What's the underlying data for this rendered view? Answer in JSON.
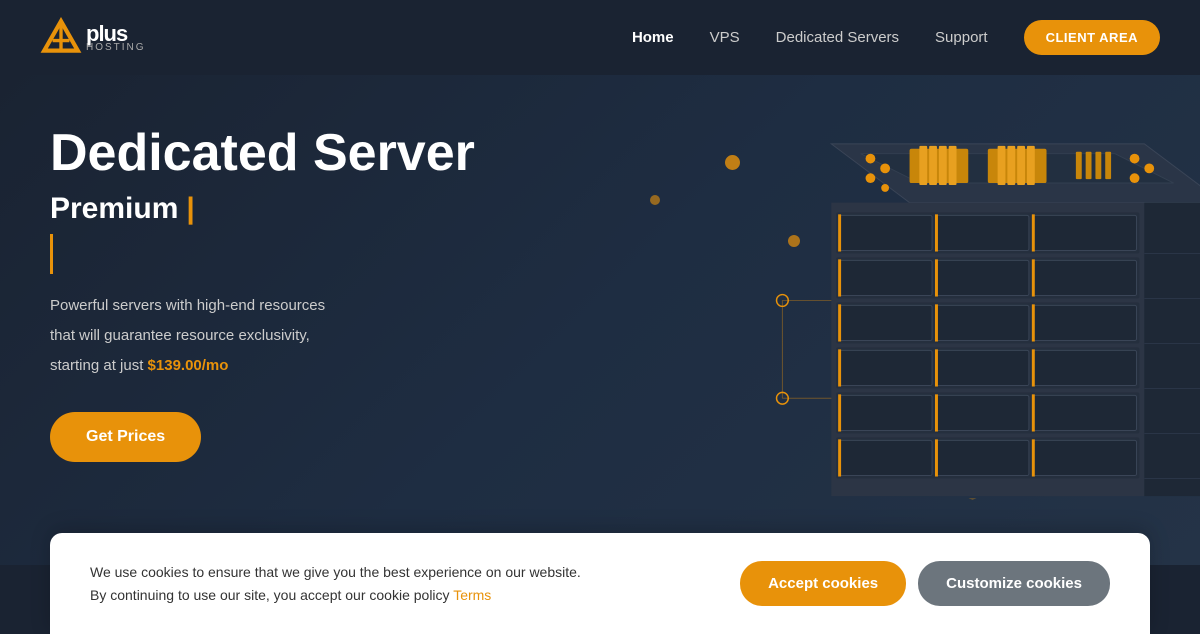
{
  "navbar": {
    "logo_plus": "plus",
    "logo_hosting": "HOSTING",
    "links": [
      {
        "label": "Home",
        "active": true
      },
      {
        "label": "VPS",
        "active": false
      },
      {
        "label": "Dedicated Servers",
        "active": false
      },
      {
        "label": "Support",
        "active": false
      }
    ],
    "client_area_label": "CLIENT AREA"
  },
  "hero": {
    "title": "Dedicated Server",
    "subtitle": "Premium",
    "subtitle_cursor": "|",
    "description_line1": "Powerful servers with high-end resources",
    "description_line2": "that will guarantee resource exclusivity,",
    "description_line3": "starting at just ",
    "price": "$139.00/mo",
    "cta_label": "Get Prices"
  },
  "cookie": {
    "message_line1": "We use cookies to ensure that we give you the best experience on our website.",
    "message_line2": "By continuing to use our site, you accept our cookie policy ",
    "terms_label": "Terms",
    "accept_label": "Accept cookies",
    "customize_label": "Customize cookies"
  },
  "colors": {
    "accent": "#e8920a",
    "bg_dark": "#1a2332",
    "text_muted": "#cccccc"
  }
}
